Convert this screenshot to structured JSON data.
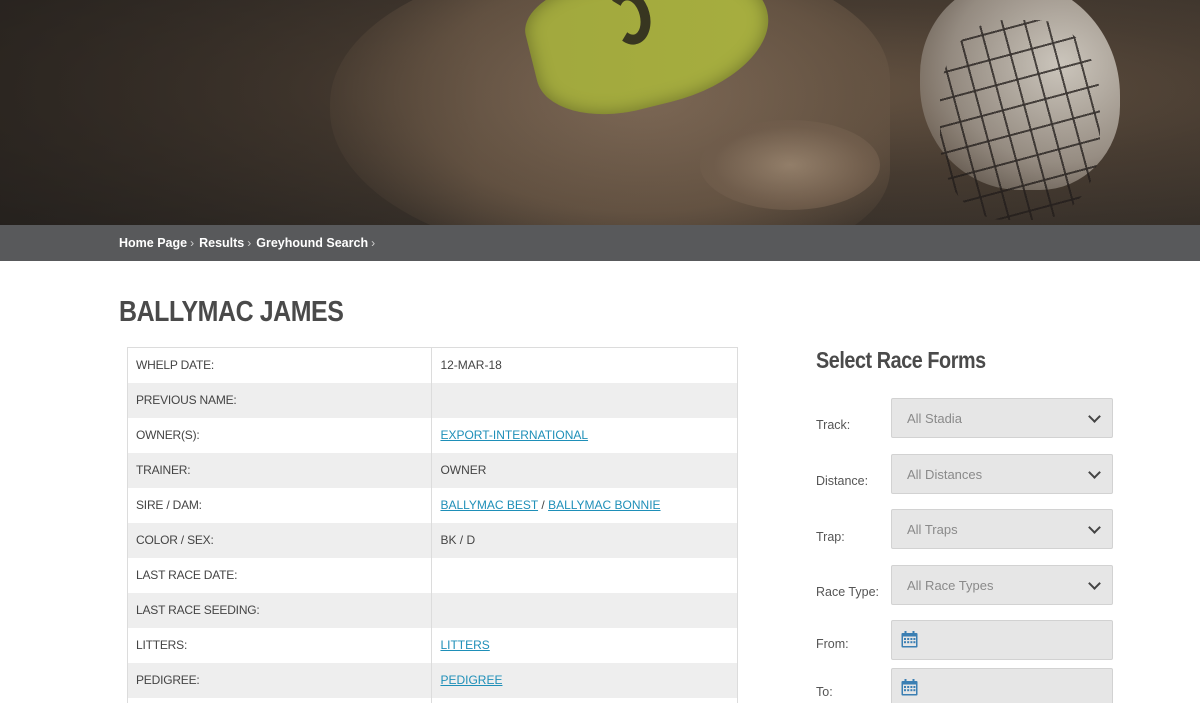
{
  "breadcrumb": [
    "Home Page",
    "Results",
    "Greyhound Search"
  ],
  "dog": {
    "name": "BALLYMAC JAMES",
    "rows": [
      {
        "label": "WHELP DATE:",
        "value": "12-MAR-18"
      },
      {
        "label": "PREVIOUS NAME:",
        "value": ""
      },
      {
        "label": "OWNER(S):",
        "link": "EXPORT-INTERNATIONAL"
      },
      {
        "label": "TRAINER:",
        "value": "OWNER"
      },
      {
        "label": "SIRE / DAM:",
        "sire": "BALLYMAC BEST",
        "separator": " / ",
        "dam": "BALLYMAC BONNIE"
      },
      {
        "label": "COLOR / SEX:",
        "value": "BK / D"
      },
      {
        "label": "LAST RACE DATE:",
        "value": ""
      },
      {
        "label": "LAST RACE SEEDING:",
        "value": ""
      },
      {
        "label": "LITTERS:",
        "link": "LITTERS"
      },
      {
        "label": "PEDIGREE:",
        "link": "PEDIGREE"
      }
    ]
  },
  "race_forms": {
    "title": "Select Race Forms",
    "track_label": "Track:",
    "track_value": "All Stadia",
    "distance_label": "Distance:",
    "distance_value": "All Distances",
    "trap_label": "Trap:",
    "trap_value": "All Traps",
    "race_type_label": "Race Type:",
    "race_type_value": "All Race Types",
    "from_label": "From:",
    "from_value": "",
    "to_label": "To:",
    "to_value": ""
  },
  "colors": {
    "link": "#1e8fb8",
    "breadcrumb_bar": "#58595b",
    "calendar_icon": "#3b7fb3"
  },
  "icons": {
    "dropdown": "chevron-down-icon",
    "date": "calendar-icon"
  }
}
